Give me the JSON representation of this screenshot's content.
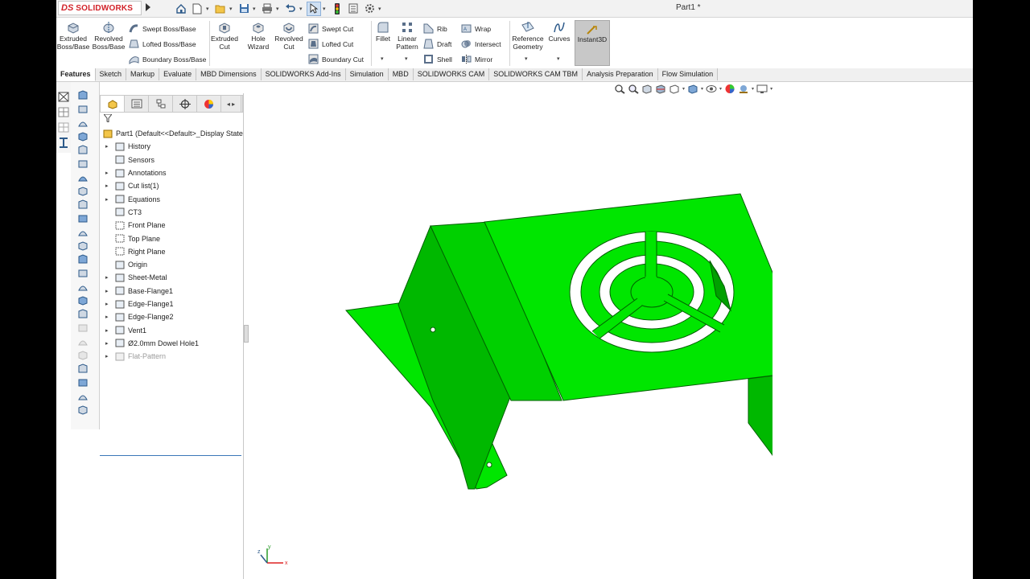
{
  "app": {
    "brand": "SOLIDWORKS",
    "ds_mark": "DS",
    "doc_title": "Part1 *"
  },
  "colors": {
    "part_fill": "#00e600",
    "part_shade": "#00b800",
    "part_edge": "#005f00",
    "brand_red": "#d2232a",
    "selection_blue": "#3a78b8"
  },
  "quick_access": [
    "home-icon",
    "new-document-icon",
    "open-icon",
    "save-icon",
    "print-icon",
    "undo-icon",
    "select-arrow-icon",
    "rebuild-icon",
    "file-properties-icon",
    "options-gear-icon"
  ],
  "ribbon": {
    "extruded_boss": "Extruded Boss/Base",
    "revolved_boss": "Revolved Boss/Base",
    "swept_boss": "Swept Boss/Base",
    "lofted_boss": "Lofted Boss/Base",
    "boundary_boss": "Boundary Boss/Base",
    "extruded_cut": "Extruded Cut",
    "hole_wizard": "Hole Wizard",
    "revolved_cut": "Revolved Cut",
    "swept_cut": "Swept Cut",
    "lofted_cut": "Lofted Cut",
    "boundary_cut": "Boundary Cut",
    "fillet": "Fillet",
    "linear_pattern": "Linear Pattern",
    "rib": "Rib",
    "draft": "Draft",
    "shell": "Shell",
    "wrap": "Wrap",
    "intersect": "Intersect",
    "mirror": "Mirror",
    "reference_geometry": "Reference Geometry",
    "curves": "Curves",
    "instant3d": "Instant3D"
  },
  "tabs": [
    "Features",
    "Sketch",
    "Markup",
    "Evaluate",
    "MBD Dimensions",
    "SOLIDWORKS Add-Ins",
    "Simulation",
    "MBD",
    "SOLIDWORKS CAM",
    "SOLIDWORKS CAM TBM",
    "Analysis Preparation",
    "Flow Simulation"
  ],
  "active_tab": "Features",
  "tree": {
    "root": "Part1  (Default<<Default>_Display State",
    "items": [
      {
        "label": "History",
        "expandable": true,
        "icon": "history-folder-icon"
      },
      {
        "label": "Sensors",
        "expandable": false,
        "icon": "sensors-icon"
      },
      {
        "label": "Annotations",
        "expandable": true,
        "icon": "annotations-icon"
      },
      {
        "label": "Cut list(1)",
        "expandable": true,
        "icon": "cut-list-icon"
      },
      {
        "label": "Equations",
        "expandable": true,
        "icon": "equations-icon"
      },
      {
        "label": "CT3",
        "expandable": false,
        "icon": "material-icon"
      },
      {
        "label": "Front Plane",
        "expandable": false,
        "icon": "plane-icon"
      },
      {
        "label": "Top Plane",
        "expandable": false,
        "icon": "plane-icon"
      },
      {
        "label": "Right Plane",
        "expandable": false,
        "icon": "plane-icon"
      },
      {
        "label": "Origin",
        "expandable": false,
        "icon": "origin-icon"
      },
      {
        "label": "Sheet-Metal",
        "expandable": true,
        "icon": "sheet-metal-icon"
      },
      {
        "label": "Base-Flange1",
        "expandable": true,
        "icon": "base-flange-icon"
      },
      {
        "label": "Edge-Flange1",
        "expandable": true,
        "icon": "edge-flange-icon"
      },
      {
        "label": "Edge-Flange2",
        "expandable": true,
        "icon": "edge-flange-icon"
      },
      {
        "label": "Vent1",
        "expandable": true,
        "icon": "vent-icon"
      },
      {
        "label": "Ø2.0mm Dowel Hole1",
        "expandable": true,
        "icon": "hole-icon"
      },
      {
        "label": "Flat-Pattern",
        "expandable": true,
        "icon": "flat-pattern-icon",
        "suppressed": true
      }
    ]
  },
  "triad": {
    "x": "x",
    "y": "y",
    "z": "z"
  }
}
